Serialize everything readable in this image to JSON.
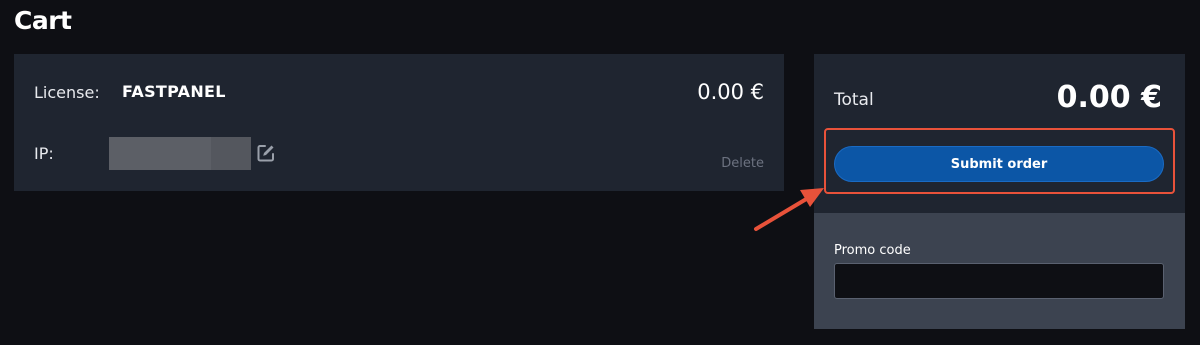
{
  "page": {
    "title": "Cart"
  },
  "cart_item": {
    "license_label": "License:",
    "license_name": "FASTPANEL",
    "price": "0.00 €",
    "ip_label": "IP:",
    "delete_label": "Delete"
  },
  "summary": {
    "total_label": "Total",
    "total_amount": "0.00 €",
    "submit_label": "Submit order"
  },
  "promo": {
    "label": "Promo code",
    "value": "",
    "placeholder": ""
  },
  "colors": {
    "background": "#0e0f14",
    "panel": "#1f2530",
    "promo_panel": "#3c4350",
    "button": "#0c56a6",
    "annotation": "#e8523a"
  },
  "icons": {
    "edit": "edit-icon",
    "arrow": "arrow-annotation"
  }
}
